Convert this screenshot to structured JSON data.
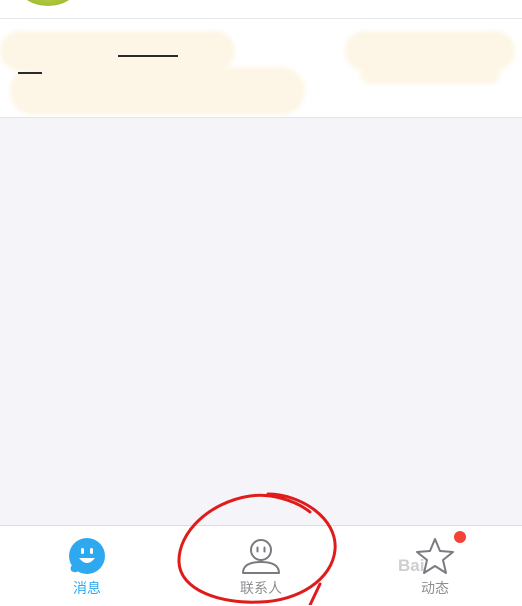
{
  "tabbar": {
    "tabs": [
      {
        "label": "消息",
        "icon": "chat-smile-icon",
        "active": true
      },
      {
        "label": "联系人",
        "icon": "person-icon",
        "active": false
      },
      {
        "label": "动态",
        "icon": "star-icon",
        "active": false,
        "badge": true
      }
    ]
  },
  "watermark": "Bai",
  "colors": {
    "accent": "#2ea9f0",
    "badge": "#f44336",
    "annotation": "#e01b1b"
  }
}
